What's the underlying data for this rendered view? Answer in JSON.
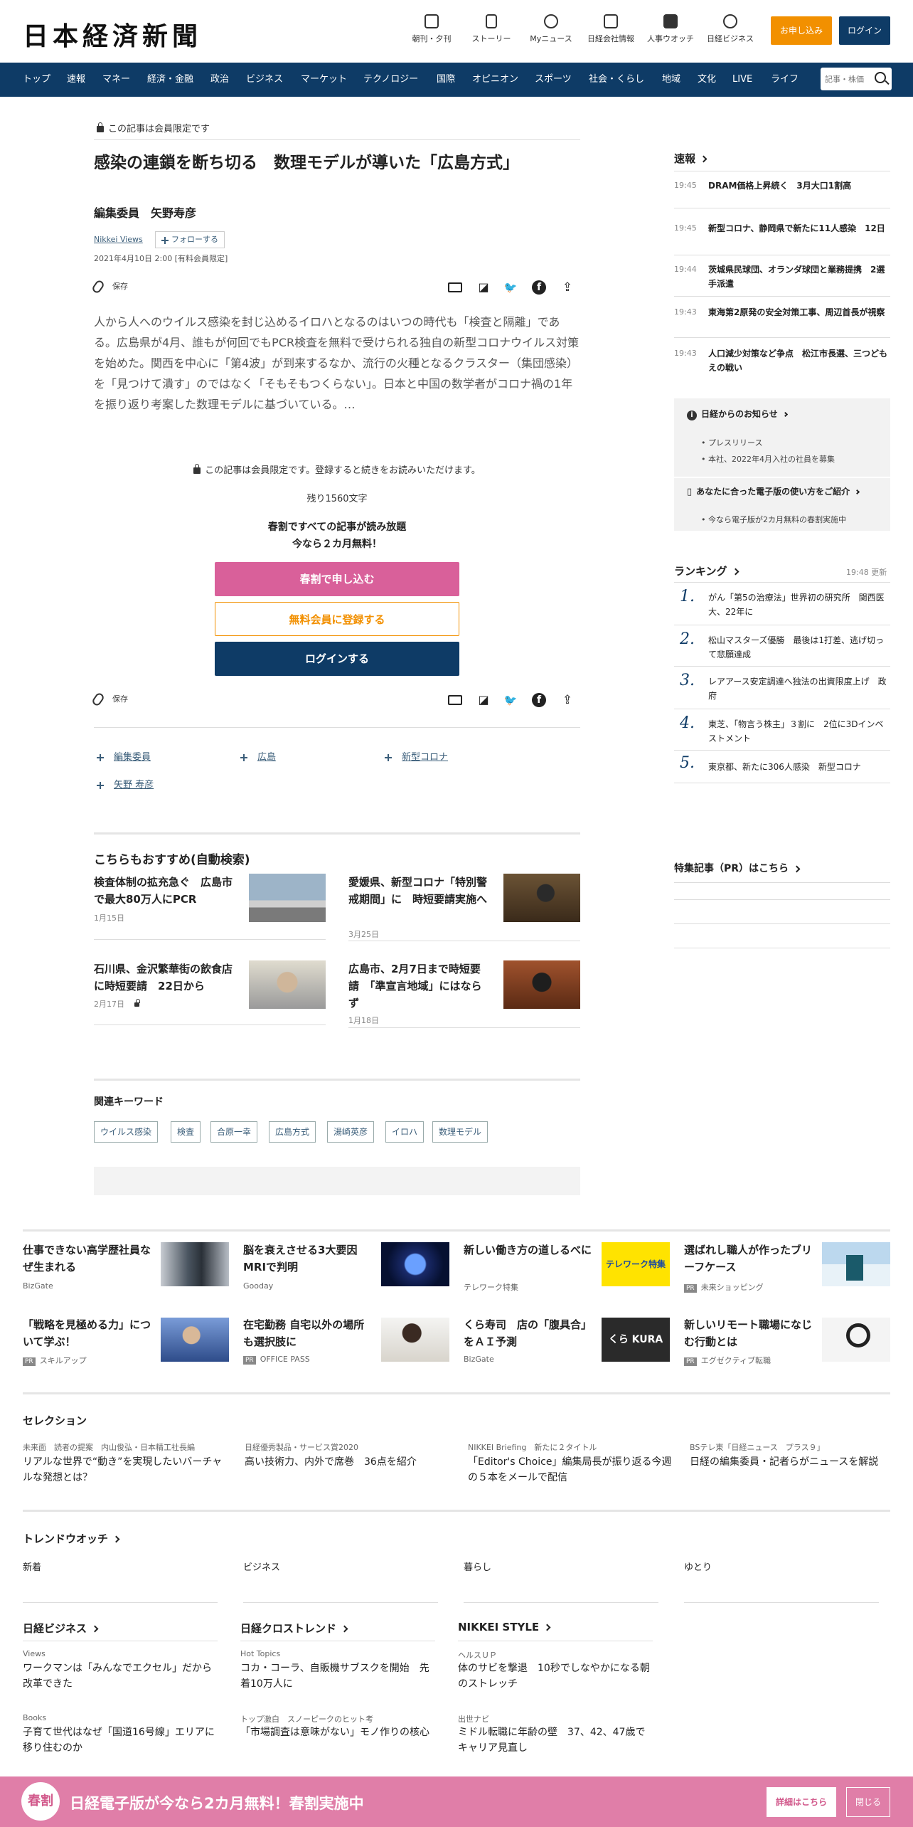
{
  "header": {
    "logo": "日本経済新聞",
    "nav_icons": [
      {
        "label": "朝刊・夕刊",
        "icon": "newspaper-icon"
      },
      {
        "label": "ストーリー",
        "icon": "document-icon"
      },
      {
        "label": "Myニュース",
        "icon": "user-icon"
      },
      {
        "label": "日経会社情報",
        "icon": "chart-icon"
      },
      {
        "label": "人事ウオッチ",
        "icon": "search-person-icon"
      },
      {
        "label": "日経ビジネス",
        "icon": "compass-icon"
      }
    ],
    "apply_label": "お申し込み",
    "login_label": "ログイン"
  },
  "nav": {
    "items": [
      "トップ",
      "速報",
      "マネー",
      "経済・金融",
      "政治",
      "ビジネス",
      "マーケット",
      "テクノロジー",
      "国際",
      "オピニオン",
      "スポーツ",
      "社会・くらし",
      "地域",
      "文化",
      "LIVE",
      "ライフ"
    ],
    "search_placeholder": "記事・株価"
  },
  "article": {
    "member_only": "この記事は会員限定です",
    "title": "感染の連鎖を断ち切る　数理モデルが導いた「広島方式」",
    "author": "編集委員　矢野寿彦",
    "series": "Nikkei Views",
    "follow": "フォローする",
    "date": "2021年4月10日 2:00 [有料会員限定]",
    "save": "保存",
    "body": "人から人へのウイルス感染を封じ込めるイロハとなるのはいつの時代も「検査と隔離」である。広島県が4月、誰もが何回でもPCR検査を無料で受けられる独自の新型コロナウイルス対策を始めた。関西を中心に「第4波」が到来するなか、流行の火種となるクラスター（集団感染）を「見つけて潰す」のではなく「そもそもつくらない」。日本と中国の数学者がコロナ禍の1年を振り返り考案した数理モデルに基づいている。…",
    "paywall_note": "この記事は会員限定です。登録すると続きをお読みいただけます。",
    "remaining": "残り1560文字",
    "promo_line1": "春割ですべての記事が読み放題",
    "promo_line2": "今なら２カ月無料！",
    "cta_spring": "春割で申し込む",
    "cta_free": "無料会員に登録する",
    "cta_login": "ログインする",
    "topics": [
      "編集委員",
      "広島",
      "新型コロナ",
      "矢野 寿彦"
    ]
  },
  "recommend": {
    "heading": "こちらもおすすめ(自動検索)",
    "items": [
      {
        "title": "検査体制の拡充急ぐ　広島市で最大80万人にPCR",
        "date": "1月15日"
      },
      {
        "title": "愛媛県、新型コロナ「特別警戒期間」に　時短要請実施へ",
        "date": "3月25日"
      },
      {
        "title": "石川県、金沢繁華街の飲食店に時短要請　22日から",
        "date": "2月17日"
      },
      {
        "title": "広島市、2月7日まで時短要請　「準宣言地域」にはならず",
        "date": "1月18日"
      }
    ]
  },
  "keywords": {
    "heading": "関連キーワード",
    "tags": [
      "ウイルス感染",
      "検査",
      "合原一幸",
      "広島方式",
      "湯崎英彦",
      "イロハ",
      "数理モデル"
    ]
  },
  "sidebar": {
    "breaking_heading": "速報",
    "breaking": [
      {
        "time": "19:45",
        "title": "DRAM価格上昇続く　3月大口1割高"
      },
      {
        "time": "19:45",
        "title": "新型コロナ、静岡県で新たに11人感染　12日"
      },
      {
        "time": "19:44",
        "title": "茨城県民球団、オランダ球団と業務提携　2選手派遣"
      },
      {
        "time": "19:43",
        "title": "東海第2原発の安全対策工事、周辺首長が視察"
      },
      {
        "time": "19:43",
        "title": "人口減少対策など争点　松江市長選、三つどもえの戦い"
      }
    ],
    "notice_heading": "日経からのお知らせ",
    "notices": [
      "プレスリリース",
      "本社、2022年4月入社の社員を募集"
    ],
    "guide_heading": "あなたに合った電子版の使い方をご紹介",
    "guide_items": [
      "今なら電子版が2カ月無料の春割実施中"
    ],
    "ranking_heading": "ランキング",
    "ranking_updated": "19:48  更新",
    "ranking": [
      "がん「第5の治療法」世界初の研究所　関西医大、22年に",
      "松山マスターズ優勝　最後は1打差、逃げ切って悲願達成",
      "レアアース安定調達へ独法の出資限度上げ　政府",
      "東芝、「物言う株主」３割に　2位に3Dインベストメント",
      "東京都、新たに306人感染　新型コロナ"
    ],
    "pr_heading": "特集記事（PR）はこちら"
  },
  "bottom_grid": [
    {
      "title": "仕事できない高学歴社員なぜ生まれる",
      "source": "BizGate",
      "pr": false
    },
    {
      "title": "脳を衰えさせる3大要因　MRIで判明",
      "source": "Gooday",
      "pr": false
    },
    {
      "title": "新しい働き方の道しるべに",
      "source": "テレワーク特集",
      "pr": false
    },
    {
      "title": "選ばれし職人が作ったブリーフケース",
      "source": "未来ショッピング",
      "pr": true
    },
    {
      "title": "「戦略を見極める力」について学ぶ！",
      "source": "スキルアップ",
      "pr": true
    },
    {
      "title": "在宅勤務 自宅以外の場所も選択肢に",
      "source": "OFFICE PASS",
      "pr": true
    },
    {
      "title": "くら寿司　店の「腹具合」をＡＩ予測",
      "source": "BizGate",
      "pr": false
    },
    {
      "title": "新しいリモート職場になじむ行動とは",
      "source": "エグゼクティブ転職",
      "pr": true
    }
  ],
  "thumb_texts": {
    "telework": "テレワーク特集",
    "kura": "くら KURA"
  },
  "selection": {
    "heading": "セレクション",
    "items": [
      {
        "category": "未来面　読者の提案　内山俊弘・日本精工社長編",
        "title": "リアルな世界で“動き”を実現したいバーチャルな発想とは？"
      },
      {
        "category": "日経優秀製品・サービス賞2020",
        "title": "高い技術力、内外で席巻　36点を紹介"
      },
      {
        "category": "NIKKEI Briefing　新たに２タイトル",
        "title": "「Editor's Choice」編集局長が振り返る今週の５本をメールで配信"
      },
      {
        "category": "BSテレ東「日経ニュース　プラス９」",
        "title": "日経の編集委員・記者らがニュースを解説"
      }
    ]
  },
  "trend": {
    "heading": "トレンドウオッチ",
    "tabs": [
      "新着",
      "ビジネス",
      "暮らし",
      "ゆとり"
    ]
  },
  "columns": [
    {
      "heading": "日経ビジネス",
      "items": [
        {
          "category": "Views",
          "title": "ワークマンは「みんなでエクセル」だから改革できた"
        },
        {
          "category": "Books",
          "title": "子育て世代はなぜ「国道16号線」エリアに移り住むのか"
        }
      ]
    },
    {
      "heading": "日経クロストレンド",
      "items": [
        {
          "category": "Hot Topics",
          "title": "コカ・コーラ、自販機サブスクを開始　先着10万人に"
        },
        {
          "category": "トップ激白　スノーピークのヒット考",
          "title": "「市場調査は意味がない」モノ作りの核心"
        }
      ]
    },
    {
      "heading": "NIKKEI STYLE",
      "items": [
        {
          "category": "ヘルスＵＰ",
          "title": "体のサビを撃退　10秒でしなやかになる朝のストレッチ"
        },
        {
          "category": "出世ナビ",
          "title": "ミドル転職に年齢の壁　37、42、47歳でキャリア見直し"
        }
      ]
    }
  ],
  "banner": {
    "badge": "春割",
    "text": "日経電子版が今なら2カ月無料！春割実施中",
    "detail": "詳細はこちら",
    "close": "閉じる"
  },
  "colors": {
    "navy": "#0e3b66",
    "orange": "#f29000",
    "pink": "#d9609a",
    "banner": "#e07ea8"
  }
}
